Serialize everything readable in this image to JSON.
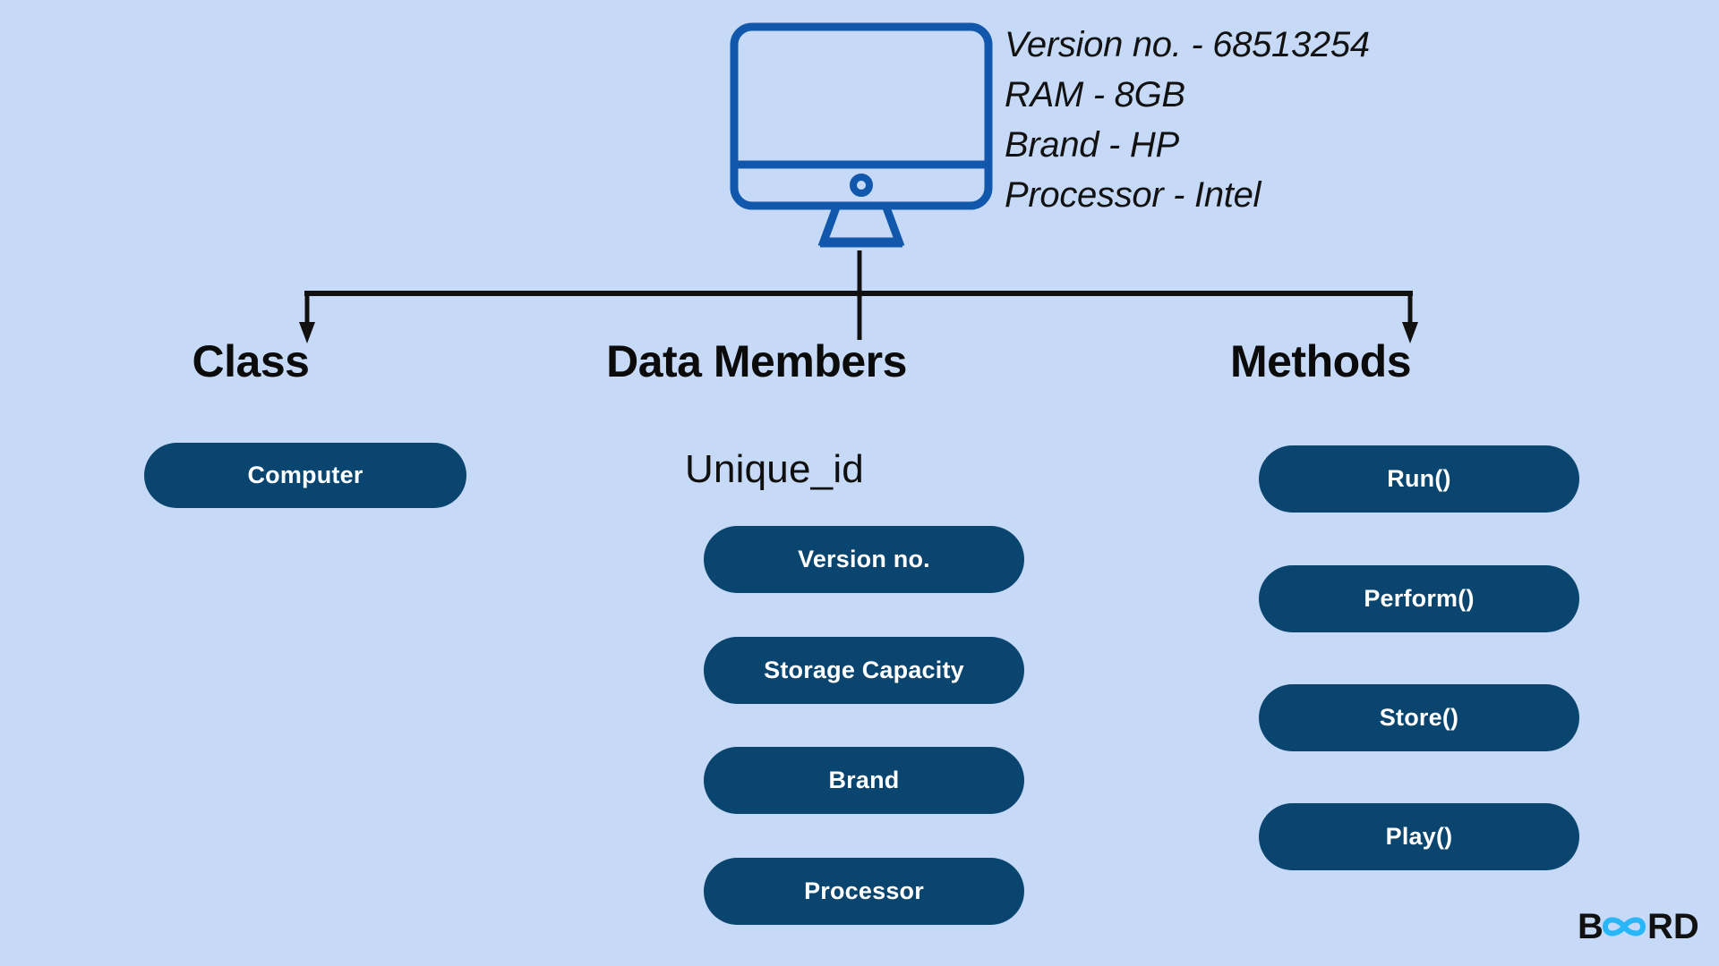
{
  "background_color": "#c6daf7",
  "accent_color": "#0a4570",
  "outline_color": "#1158ad",
  "device": {
    "icon": "desktop-monitor-icon",
    "specs": [
      "Version no. - 68513254",
      "RAM - 8GB",
      "Brand - HP",
      "Processor - Intel"
    ]
  },
  "columns": [
    {
      "id": "class",
      "heading": "Class",
      "items": [
        "Computer"
      ]
    },
    {
      "id": "data-members",
      "heading": "Data Members",
      "subtitle": "Unique_id",
      "items": [
        "Version no.",
        "Storage Capacity",
        "Brand",
        "Processor"
      ]
    },
    {
      "id": "methods",
      "heading": "Methods",
      "items": [
        "Run()",
        "Perform()",
        "Store()",
        "Play()"
      ]
    }
  ],
  "logo": {
    "text_left": "B",
    "text_mark": "∞a",
    "text_right": "RD",
    "full": "BOARD",
    "mark_color": "#28b6f6",
    "text_color": "#111111"
  }
}
